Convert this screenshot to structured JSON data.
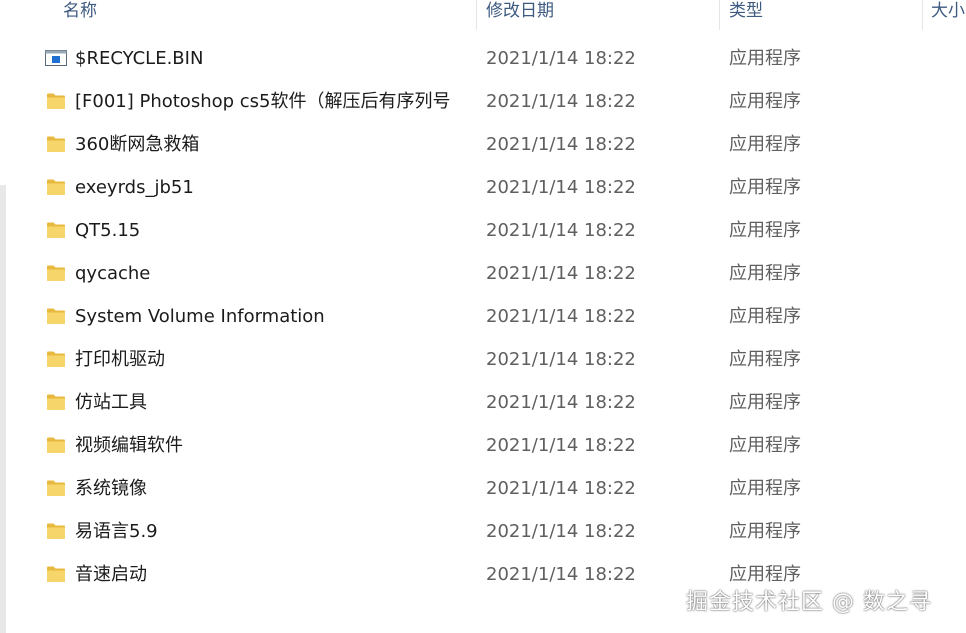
{
  "columns": {
    "name": "名称",
    "date_modified": "修改日期",
    "type": "类型",
    "size": "大小"
  },
  "files": [
    {
      "name": "$RECYCLE.BIN",
      "date": "2021/1/14 18:22",
      "type": "应用程序",
      "icon": "recycle-bin-icon"
    },
    {
      "name": "[F001] Photoshop cs5软件（解压后有序列号",
      "date": "2021/1/14 18:22",
      "type": "应用程序",
      "icon": "folder-icon"
    },
    {
      "name": "360断网急救箱",
      "date": "2021/1/14 18:22",
      "type": "应用程序",
      "icon": "folder-icon"
    },
    {
      "name": "exeyrds_jb51",
      "date": "2021/1/14 18:22",
      "type": "应用程序",
      "icon": "folder-icon"
    },
    {
      "name": "QT5.15",
      "date": "2021/1/14 18:22",
      "type": "应用程序",
      "icon": "folder-icon"
    },
    {
      "name": "qycache",
      "date": "2021/1/14 18:22",
      "type": "应用程序",
      "icon": "folder-icon"
    },
    {
      "name": "System Volume Information",
      "date": "2021/1/14 18:22",
      "type": "应用程序",
      "icon": "folder-icon"
    },
    {
      "name": "打印机驱动",
      "date": "2021/1/14 18:22",
      "type": "应用程序",
      "icon": "folder-icon"
    },
    {
      "name": "仿站工具",
      "date": "2021/1/14 18:22",
      "type": "应用程序",
      "icon": "folder-icon"
    },
    {
      "name": "视频编辑软件",
      "date": "2021/1/14 18:22",
      "type": "应用程序",
      "icon": "folder-icon"
    },
    {
      "name": "系统镜像",
      "date": "2021/1/14 18:22",
      "type": "应用程序",
      "icon": "folder-icon"
    },
    {
      "name": "易语言5.9",
      "date": "2021/1/14 18:22",
      "type": "应用程序",
      "icon": "folder-icon"
    },
    {
      "name": "音速启动",
      "date": "2021/1/14 18:22",
      "type": "应用程序",
      "icon": "folder-icon"
    }
  ],
  "watermark": "掘金技术社区 @ 数之寻",
  "colors": {
    "folder": "#f6d56a",
    "folder_dark": "#e8b93f",
    "header_text": "#3d5a80"
  }
}
